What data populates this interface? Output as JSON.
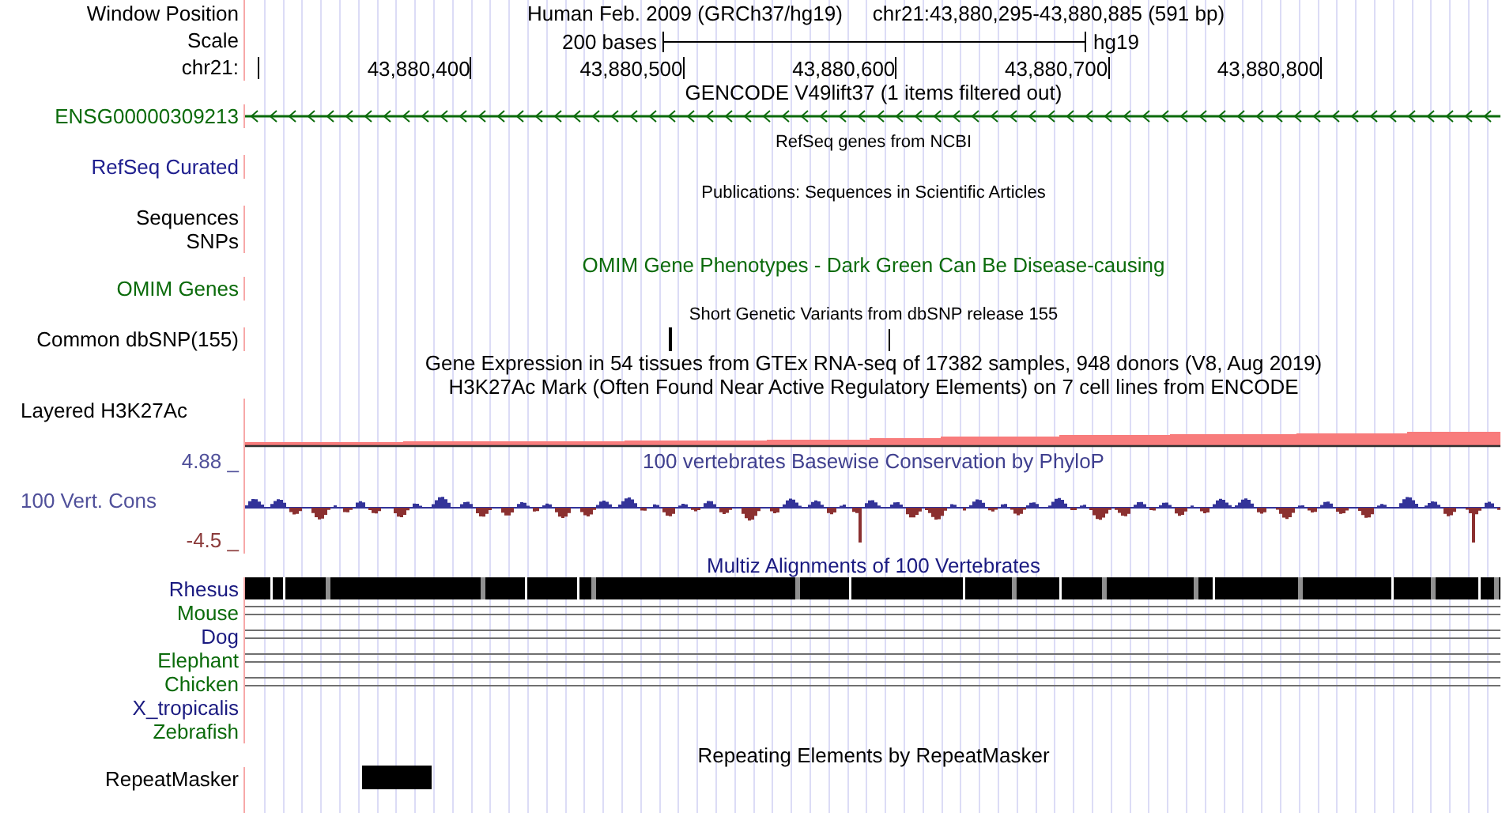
{
  "header": {
    "position_label": "Window Position",
    "title": "Human Feb. 2009 (GRCh37/hg19)",
    "position": "chr21:43,880,295-43,880,885 (591 bp)",
    "scale_label": "Scale",
    "scale_text": "200 bases",
    "assembly": "hg19",
    "chrom_label": "chr21:",
    "ticks": [
      "43,880,400",
      "43,880,500",
      "43,880,600",
      "43,880,700",
      "43,880,800"
    ]
  },
  "tracks": [
    {
      "kind": "gene",
      "title": {
        "text": "GENCODE V49lift37 (1 items filtered out)",
        "kind": "heading",
        "color": "#000000"
      },
      "labels": [
        {
          "text": "ENSG00000309213",
          "kind": "track",
          "color": "#0b6b0b"
        }
      ]
    },
    {
      "kind": "empty",
      "title": {
        "text": "RefSeq genes from NCBI",
        "kind": "note",
        "color": "#000000"
      },
      "labels": [
        {
          "text": "RefSeq Curated",
          "kind": "track",
          "color": "#20208f"
        }
      ]
    },
    {
      "kind": "empty",
      "title": {
        "text": "Publications: Sequences in Scientific Articles",
        "kind": "note",
        "color": "#000000"
      },
      "labels": [
        {
          "text": "Sequences",
          "kind": "track",
          "color": "#000000"
        },
        {
          "text": "SNPs",
          "kind": "track",
          "color": "#000000"
        }
      ]
    },
    {
      "kind": "empty",
      "title": {
        "text": "OMIM Gene Phenotypes - Dark Green Can Be Disease-causing",
        "kind": "heading",
        "color": "#0b6b0b"
      },
      "labels": [
        {
          "text": "OMIM Genes",
          "kind": "track",
          "color": "#0b6b0b"
        }
      ]
    },
    {
      "kind": "snp",
      "title": {
        "text": "Short Genetic Variants from dbSNP release 155",
        "kind": "note",
        "color": "#000000"
      },
      "labels": [
        {
          "text": "Common dbSNP(155)",
          "kind": "track",
          "color": "#000000"
        }
      ]
    },
    {
      "kind": "empty",
      "title": {
        "text": "Gene Expression in 54 tissues from GTEx RNA-seq of 17382 samples, 948 donors (V8, Aug 2019)",
        "kind": "heading",
        "color": "#000000"
      }
    },
    {
      "kind": "density",
      "title": {
        "text": "H3K27Ac Mark (Often Found Near Active Regulatory Elements) on 7 cell lines from ENCODE",
        "kind": "heading",
        "color": "#000000"
      },
      "labels": [
        {
          "text": "Layered H3K27Ac",
          "kind": "side",
          "color": "#000000"
        }
      ]
    },
    {
      "kind": "wiggle",
      "title": {
        "text": "100 vertebrates Basewise Conservation by PhyloP",
        "kind": "heading",
        "color": "#40408f"
      },
      "labels": [
        {
          "text": "4.88 _",
          "kind": "track",
          "color": "#50509a"
        },
        {
          "text": "100 Vert. Cons",
          "kind": "side",
          "color": "#50509a"
        },
        {
          "text": "-4.5 _",
          "kind": "track",
          "color": "#8b3a3a"
        }
      ]
    },
    {
      "kind": "multiz",
      "title": {
        "text": "Multiz Alignments of 100 Vertebrates",
        "kind": "heading",
        "color": "#1a1a80"
      },
      "labels": [
        {
          "text": "Rhesus",
          "kind": "bar",
          "color": "#1a1a80"
        },
        {
          "text": "Mouse",
          "kind": "lines",
          "color": "#0b6b0b"
        },
        {
          "text": "Dog",
          "kind": "lines",
          "color": "#1a1a80"
        },
        {
          "text": "Elephant",
          "kind": "lines",
          "color": "#0b6b0b"
        },
        {
          "text": "Chicken",
          "kind": "lines",
          "color": "#0b6b0b"
        },
        {
          "text": "X_tropicalis",
          "kind": "none",
          "color": "#1a1a80"
        },
        {
          "text": "Zebrafish",
          "kind": "none",
          "color": "#0b6b0b"
        }
      ]
    },
    {
      "kind": "repeat",
      "title": {
        "text": "Repeating Elements by RepeatMasker",
        "kind": "heading",
        "color": "#000000"
      },
      "labels": [
        {
          "text": "RepeatMasker",
          "kind": "track",
          "color": "#000000"
        }
      ]
    }
  ]
}
